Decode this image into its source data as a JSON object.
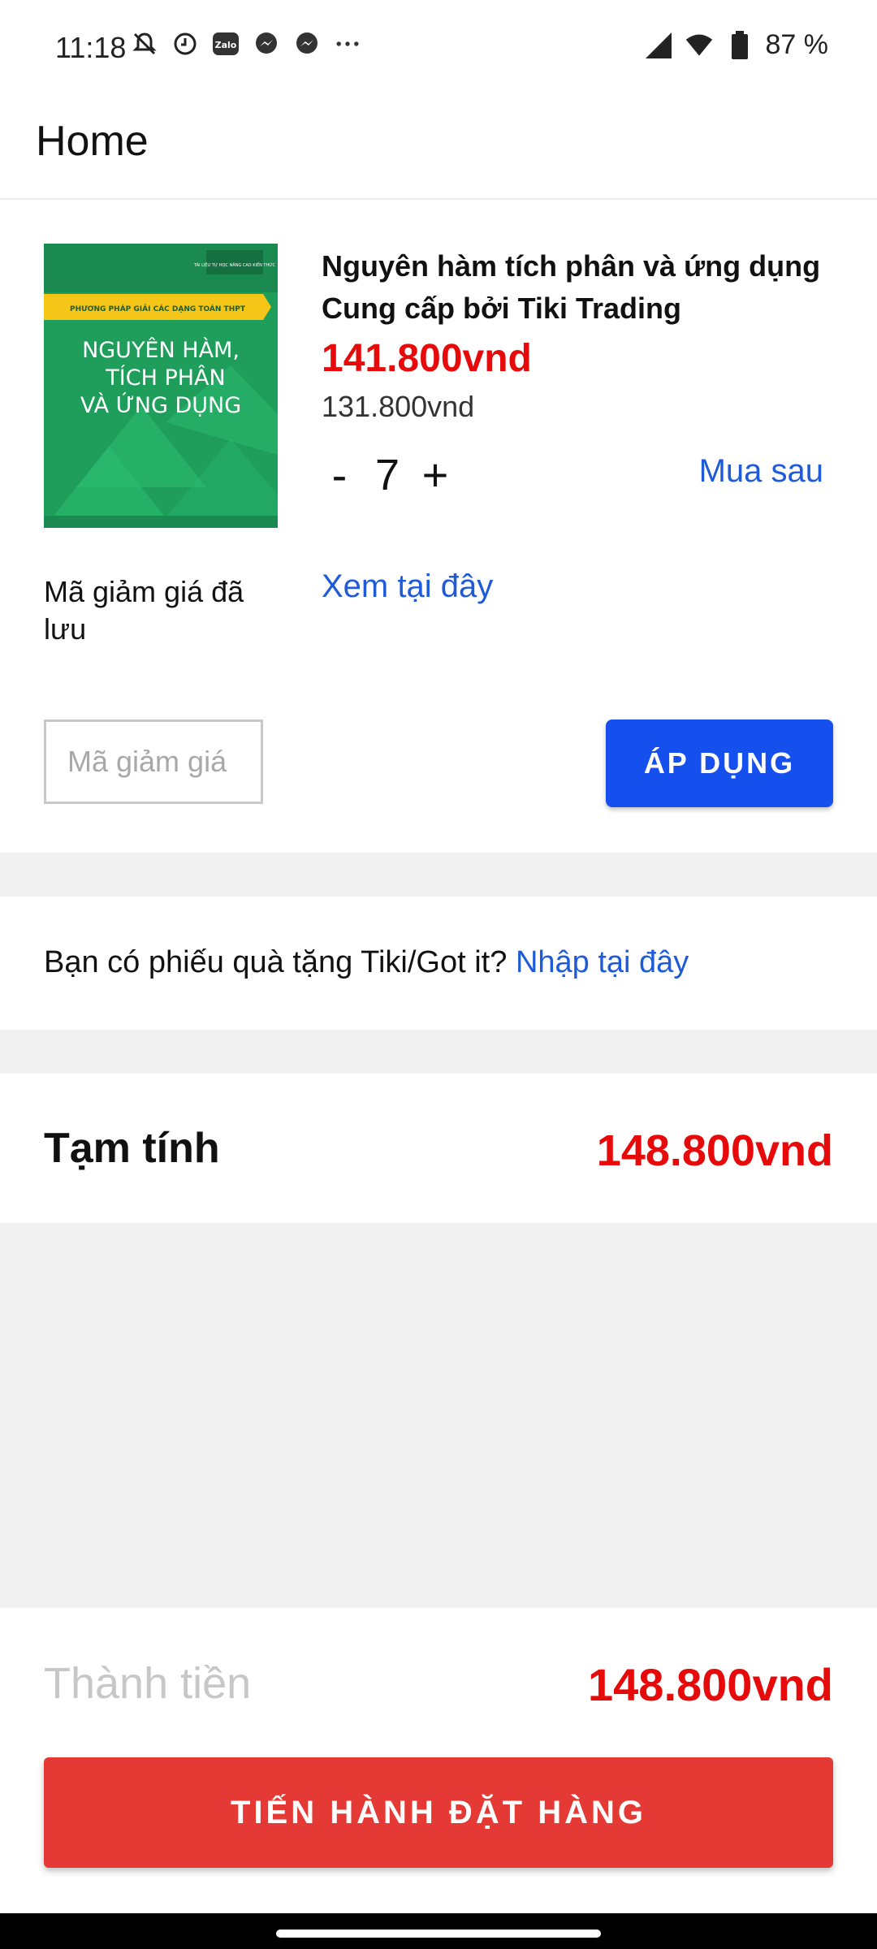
{
  "status_bar": {
    "time": "11:18",
    "battery": "87 %",
    "icons_left": [
      "muted-bell-icon",
      "clock-icon",
      "zalo-icon",
      "messenger-icon",
      "messenger-icon",
      "more-dots-icon"
    ],
    "icons_right": [
      "signal-icon",
      "wifi-icon",
      "battery-icon"
    ]
  },
  "app_bar": {
    "title": "Home"
  },
  "product": {
    "name": "Nguyên hàm tích phân và ứng dụng",
    "seller": "Cung cấp bởi Tiki Trading",
    "sale_price": "141.800vnd",
    "original_price": "131.800vnd",
    "quantity": "7",
    "minus_label": "-",
    "plus_label": "+",
    "buy_later": "Mua sau",
    "cover": {
      "ribbon": "PHƯƠNG PHÁP GIẢI CÁC DẠNG TOÁN THPT",
      "title_line1": "NGUYÊN HÀM,",
      "title_line2": "TÍCH PHÂN",
      "title_line3": "VÀ ỨNG DỤNG",
      "top_tag": "TÀI LIỆU TỰ HỌC NÂNG CAO KIẾN THỨC",
      "color": "#1f9d5b"
    }
  },
  "coupon": {
    "saved_label": "Mã giảm giá đã lưu",
    "see_here": "Xem tại đây",
    "placeholder": "Mã giảm giá",
    "apply_label": "ÁP DỤNG"
  },
  "gift": {
    "text": "Bạn có phiếu quà tặng Tiki/Got it?",
    "link": "Nhập tại đây"
  },
  "subtotal": {
    "label": "Tạm tính",
    "value": "148.800vnd"
  },
  "total": {
    "label": "Thành tiền",
    "value": "148.800vnd"
  },
  "checkout": {
    "label": "TIẾN HÀNH ĐẶT HÀNG"
  },
  "colors": {
    "accent_blue": "#1550ee",
    "price_red": "#e60a0a",
    "checkout_red": "#e53935"
  }
}
